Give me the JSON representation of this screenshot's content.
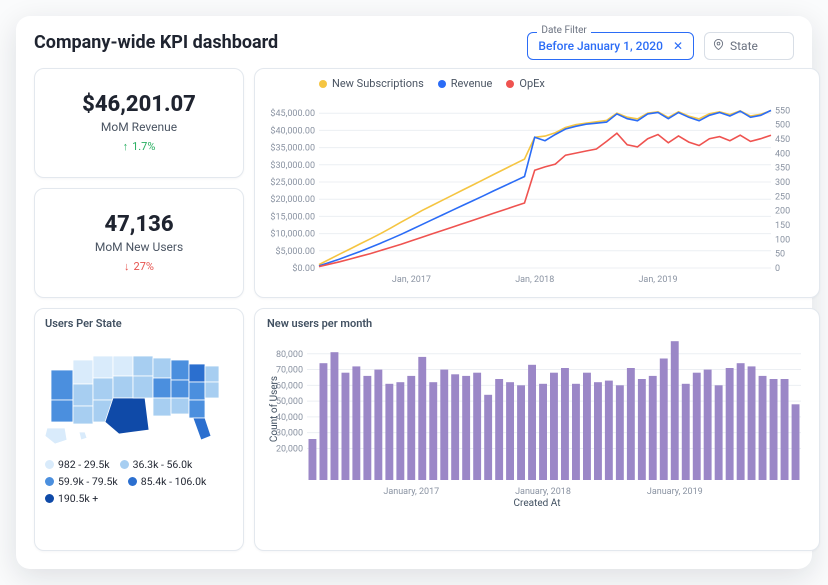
{
  "header": {
    "title": "Company-wide KPI dashboard",
    "date_filter_label": "Date Filter",
    "date_filter_value": "Before January 1, 2020",
    "date_filter_clear_icon": "close-icon",
    "state_filter_placeholder": "State",
    "state_filter_icon": "map-pin-icon"
  },
  "kpi": {
    "revenue": {
      "value": "$46,201.07",
      "label": "MoM Revenue",
      "delta_dir": "up",
      "delta_text": "1.7%"
    },
    "new_users": {
      "value": "47,136",
      "label": "MoM New Users",
      "delta_dir": "down",
      "delta_text": "27%"
    }
  },
  "line_chart": {
    "legend": {
      "new_subs": "New Subscriptions",
      "revenue": "Revenue",
      "opex": "OpEx"
    }
  },
  "map": {
    "title": "Users Per State",
    "legend": [
      {
        "color": "#d9ebfb",
        "label": "982 - 29.5k"
      },
      {
        "color": "#a7cef1",
        "label": "36.3k - 56.0k"
      },
      {
        "color": "#4b8fde",
        "label": "59.9k - 79.5k"
      },
      {
        "color": "#2b6fcf",
        "label": "85.4k - 106.0k"
      },
      {
        "color": "#0f4aa8",
        "label": "190.5k +"
      }
    ]
  },
  "bar_chart": {
    "title": "New users per month",
    "ylabel": "Count of Users",
    "xlabel": "Created At"
  },
  "chart_data": [
    {
      "type": "line",
      "title": "",
      "xlabel": "",
      "ylabel_left": "",
      "ylabel_right": "",
      "ylim_left": [
        0,
        50000
      ],
      "ylim_right": [
        0,
        600
      ],
      "y_ticks_left": [
        0,
        5000,
        10000,
        15000,
        20000,
        25000,
        30000,
        35000,
        40000,
        45000
      ],
      "y_tick_labels_left": [
        "$0.00",
        "$5,000.00",
        "$10,000.00",
        "$15,000.00",
        "$20,000.00",
        "$25,000.00",
        "$30,000.00",
        "$35,000.00",
        "$40,000.00",
        "$45,000.00"
      ],
      "y_ticks_right": [
        0,
        50,
        100,
        150,
        200,
        250,
        300,
        350,
        400,
        450,
        500,
        550
      ],
      "x_tick_labels": [
        "Jan, 2017",
        "Jan, 2018",
        "Jan, 2019"
      ],
      "x": [
        "2016-04",
        "2016-05",
        "2016-06",
        "2016-07",
        "2016-08",
        "2016-09",
        "2016-10",
        "2016-11",
        "2016-12",
        "2017-01",
        "2017-02",
        "2017-03",
        "2017-04",
        "2017-05",
        "2017-06",
        "2017-07",
        "2017-08",
        "2017-09",
        "2017-10",
        "2017-11",
        "2017-12",
        "2018-01",
        "2018-02",
        "2018-03",
        "2018-04",
        "2018-05",
        "2018-06",
        "2018-07",
        "2018-08",
        "2018-09",
        "2018-10",
        "2018-11",
        "2018-12",
        "2019-01",
        "2019-02",
        "2019-03",
        "2019-04",
        "2019-05",
        "2019-06",
        "2019-07",
        "2019-08",
        "2019-09",
        "2019-10",
        "2019-11",
        "2019-12"
      ],
      "series": [
        {
          "name": "New Subscriptions",
          "axis": "right",
          "color": "#f5c542",
          "values": [
            12,
            30,
            48,
            66,
            84,
            102,
            120,
            140,
            160,
            180,
            200,
            218,
            236,
            254,
            272,
            290,
            308,
            326,
            344,
            362,
            380,
            456,
            460,
            472,
            490,
            500,
            505,
            510,
            515,
            540,
            526,
            520,
            540,
            545,
            525,
            545,
            530,
            520,
            538,
            545,
            535,
            548,
            530,
            536,
            549
          ]
        },
        {
          "name": "Revenue",
          "axis": "left",
          "color": "#2b6cf6",
          "values": [
            600,
            1600,
            2600,
            3700,
            4800,
            6000,
            7200,
            8500,
            9800,
            11200,
            12600,
            14000,
            15400,
            16800,
            18200,
            19600,
            21000,
            22400,
            23800,
            25200,
            26600,
            38000,
            37000,
            38800,
            40400,
            41200,
            41800,
            42100,
            42400,
            44800,
            43400,
            42800,
            44800,
            45200,
            43400,
            45200,
            43800,
            42800,
            44400,
            45200,
            44200,
            45600,
            43800,
            44400,
            45800
          ]
        },
        {
          "name": "OpEx",
          "axis": "left",
          "color": "#ef5350",
          "values": [
            400,
            1100,
            1800,
            2600,
            3400,
            4200,
            5100,
            6000,
            6900,
            7900,
            8900,
            9900,
            10900,
            11900,
            12900,
            13900,
            14900,
            15900,
            16900,
            17900,
            18900,
            28400,
            29400,
            30200,
            32800,
            33400,
            34000,
            34600,
            36800,
            39200,
            35800,
            35200,
            37600,
            38800,
            36400,
            38400,
            36600,
            35600,
            37600,
            38200,
            37000,
            38600,
            36800,
            37600,
            38600
          ]
        }
      ]
    },
    {
      "type": "bar",
      "title": "New users per month",
      "xlabel": "Created At",
      "ylabel": "Count of Users",
      "ylim": [
        0,
        90000
      ],
      "y_ticks": [
        20000,
        30000,
        40000,
        50000,
        60000,
        70000,
        80000
      ],
      "x_tick_labels": [
        "January, 2017",
        "January, 2018",
        "January, 2019"
      ],
      "categories": [
        "2016-04",
        "2016-05",
        "2016-06",
        "2016-07",
        "2016-08",
        "2016-09",
        "2016-10",
        "2016-11",
        "2016-12",
        "2017-01",
        "2017-02",
        "2017-03",
        "2017-04",
        "2017-05",
        "2017-06",
        "2017-07",
        "2017-08",
        "2017-09",
        "2017-10",
        "2017-11",
        "2017-12",
        "2018-01",
        "2018-02",
        "2018-03",
        "2018-04",
        "2018-05",
        "2018-06",
        "2018-07",
        "2018-08",
        "2018-09",
        "2018-10",
        "2018-11",
        "2018-12",
        "2019-01",
        "2019-02",
        "2019-03",
        "2019-04",
        "2019-05",
        "2019-06",
        "2019-07",
        "2019-08",
        "2019-09",
        "2019-10",
        "2019-11",
        "2019-12"
      ],
      "values": [
        26000,
        74000,
        81000,
        68000,
        72000,
        66000,
        70000,
        61000,
        62000,
        66000,
        78000,
        62000,
        70000,
        67000,
        66000,
        68000,
        54000,
        64000,
        62000,
        60000,
        73000,
        61000,
        68000,
        71000,
        61000,
        68000,
        62000,
        63000,
        60000,
        71000,
        64000,
        66000,
        77000,
        88000,
        61000,
        68000,
        70000,
        60000,
        71000,
        74000,
        72000,
        66000,
        64000,
        64000,
        48000
      ]
    }
  ]
}
